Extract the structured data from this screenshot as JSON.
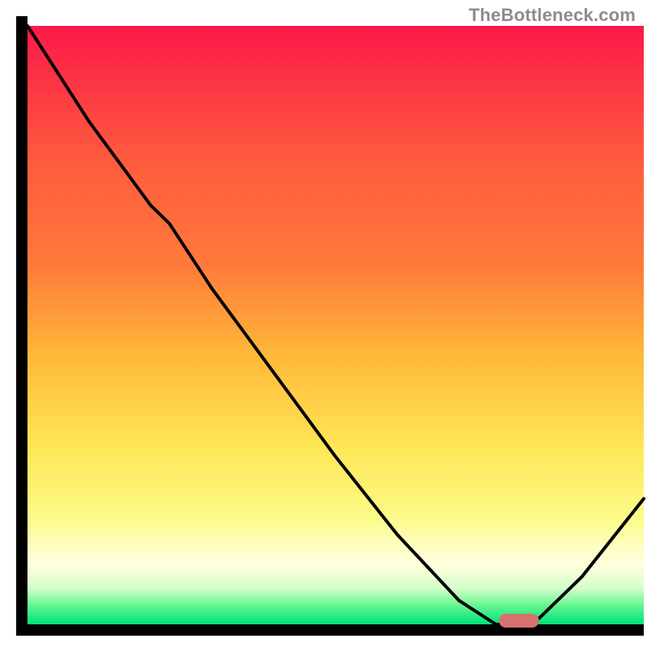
{
  "attribution": "TheBottleneck.com",
  "colors": {
    "top": "#fb1949",
    "mid1": "#ff7a3a",
    "mid2": "#ffb83a",
    "mid3": "#ffe554",
    "mid4": "#fbfb87",
    "mid5": "#ffffe0",
    "green_light": "#d4feca",
    "green_mid": "#5ff58f",
    "green": "#00e17a",
    "axis": "#000000",
    "curve": "#000000",
    "marker_fill": "#d6716e",
    "marker_stroke": "#c1514d"
  },
  "chart_data": {
    "type": "line",
    "x": [
      0.0,
      0.05,
      0.1,
      0.15,
      0.2,
      0.23,
      0.3,
      0.4,
      0.5,
      0.6,
      0.7,
      0.76,
      0.8,
      0.83,
      0.9,
      1.0
    ],
    "values": [
      1.0,
      0.92,
      0.84,
      0.77,
      0.7,
      0.67,
      0.56,
      0.42,
      0.28,
      0.15,
      0.04,
      0.0,
      0.0,
      0.01,
      0.08,
      0.21
    ],
    "title": "",
    "xlabel": "",
    "ylabel": "",
    "xlim": [
      0,
      1
    ],
    "ylim": [
      0,
      1
    ],
    "marker": {
      "x0": 0.765,
      "x1": 0.83,
      "y": 0.0
    }
  }
}
